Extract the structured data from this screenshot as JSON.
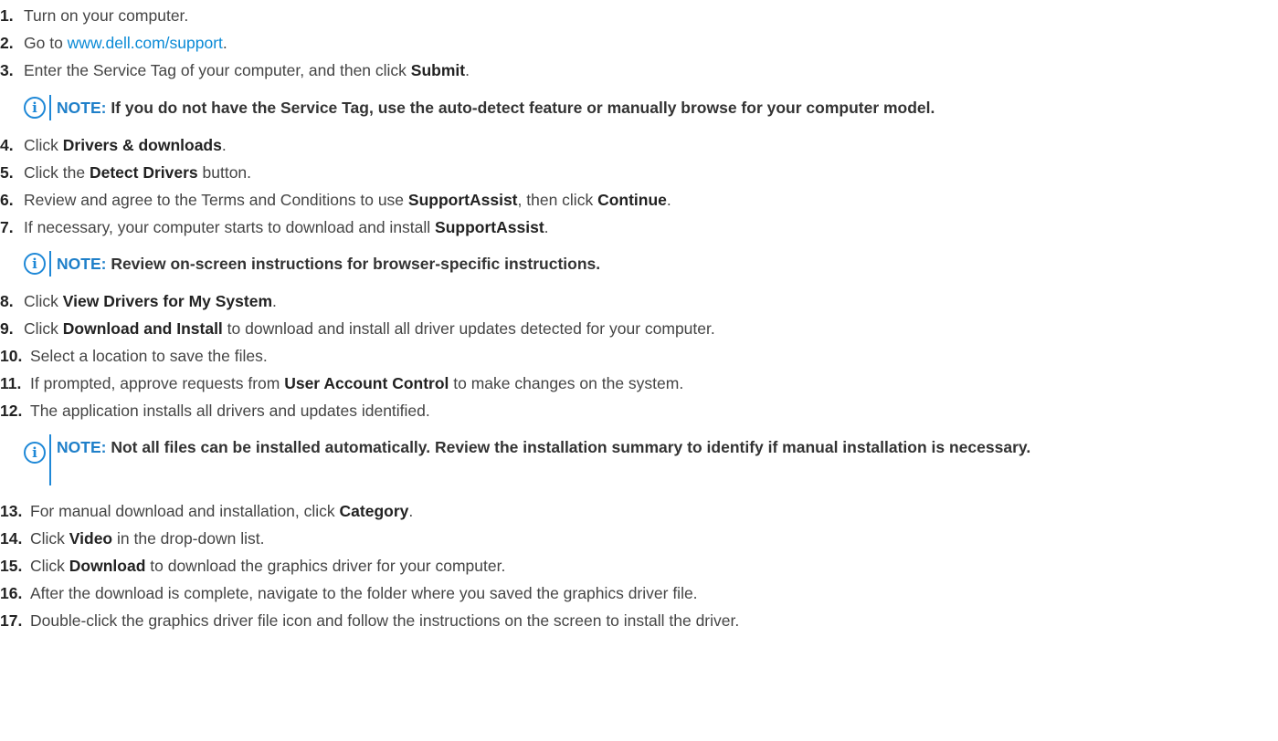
{
  "steps": [
    {
      "num": "1.",
      "text": [
        "Turn on your computer."
      ]
    },
    {
      "num": "2.",
      "pre": "Go to ",
      "link": "www.dell.com/support",
      "post": "."
    },
    {
      "num": "3.",
      "pre": "Enter the Service Tag of your computer, and then click ",
      "bold": "Submit",
      "post": "."
    },
    {
      "num": "4.",
      "pre": "Click ",
      "bold": "Drivers & downloads",
      "post": "."
    },
    {
      "num": "5.",
      "pre": "Click the ",
      "bold": "Detect Drivers",
      "post": " button."
    },
    {
      "num": "6.",
      "pre": "Review and agree to the Terms and Conditions to use ",
      "bold": "SupportAssist",
      "mid": ", then click ",
      "bold2": "Continue",
      "post": "."
    },
    {
      "num": "7.",
      "pre": "If necessary, your computer starts to download and install ",
      "bold": "SupportAssist",
      "post": "."
    },
    {
      "num": "8.",
      "pre": "Click ",
      "bold": "View Drivers for My System",
      "post": "."
    },
    {
      "num": "9.",
      "pre": "Click ",
      "bold": "Download and Install",
      "post": " to download and install all driver updates detected for your computer."
    },
    {
      "num": "10.",
      "text": [
        "Select a location to save the files."
      ]
    },
    {
      "num": "11.",
      "pre": "If prompted, approve requests from ",
      "bold": "User Account Control",
      "post": " to make changes on the system."
    },
    {
      "num": "12.",
      "text": [
        "The application installs all drivers and updates identified."
      ]
    },
    {
      "num": "13.",
      "pre": "For manual download and installation, click ",
      "bold": "Category",
      "post": "."
    },
    {
      "num": "14.",
      "pre": "Click ",
      "bold": "Video",
      "post": " in the drop-down list."
    },
    {
      "num": "15.",
      "pre": "Click ",
      "bold": "Download",
      "post": " to download the graphics driver for your computer."
    },
    {
      "num": "16.",
      "text": [
        "After the download is complete, navigate to the folder where you saved the graphics driver file."
      ]
    },
    {
      "num": "17.",
      "text": [
        "Double-click the graphics driver file icon and follow the instructions on the screen to install the driver."
      ]
    }
  ],
  "notes": {
    "label": "NOTE:",
    "icon": "info-icon",
    "note1": " If you do not have the Service Tag, use the auto-detect feature or manually browse for your computer model.",
    "note2": " Review on-screen instructions for browser-specific instructions.",
    "note3": " Not all files can be installed automatically. Review the installation summary to identify if manual installation is necessary."
  },
  "colors": {
    "link": "#0a8ad6",
    "note_accent": "#1e88d7"
  }
}
